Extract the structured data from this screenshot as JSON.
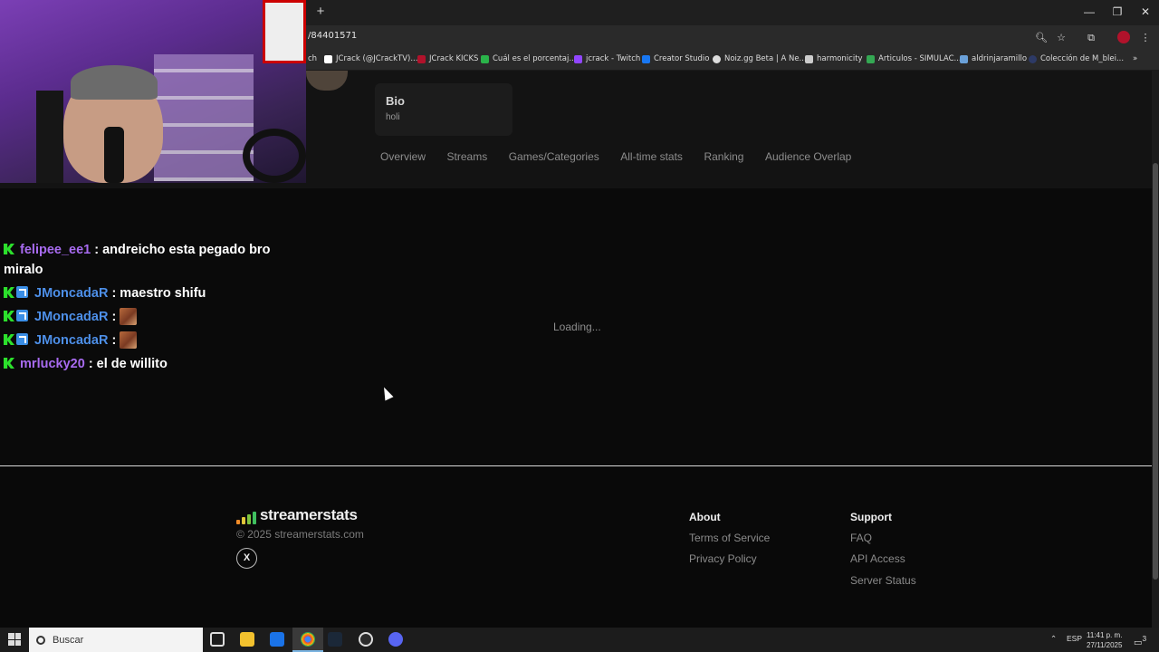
{
  "browser": {
    "url": "/84401571",
    "bookmarks": [
      {
        "label": "ch",
        "color": "#2a2a2a"
      },
      {
        "label": "JCrack (@JCrackTV)...",
        "color": "#ffffff"
      },
      {
        "label": "JCrack KICKS",
        "color": "#b1122b"
      },
      {
        "label": "Cuál es el porcentaj...",
        "color": "#2ab34a"
      },
      {
        "label": "jcrack - Twitch",
        "color": "#9146ff"
      },
      {
        "label": "Creator Studio",
        "color": "#1877f2"
      },
      {
        "label": "Noiz.gg Beta | A Ne...",
        "color": "#dddddd"
      },
      {
        "label": "harmonicity",
        "color": "#cccccc"
      },
      {
        "label": "Articulos - SIMULAC...",
        "color": "#34a853"
      },
      {
        "label": "aldrinjaramillo",
        "color": "#6aa0d8"
      },
      {
        "label": "Colección de M_blei...",
        "color": "#2d3a66"
      }
    ]
  },
  "profile": {
    "bio_title": "Bio",
    "bio_text": "holi",
    "tabs": [
      "Overview",
      "Streams",
      "Games/Categories",
      "All-time stats",
      "Ranking",
      "Audience Overlap"
    ],
    "loading": "Loading..."
  },
  "chat": {
    "messages": [
      {
        "user": "felipee_ee1",
        "text": ": andreicho esta pegado bro miralo",
        "badges": [
          "k"
        ],
        "color": "purple"
      },
      {
        "user": "JMoncadaR",
        "text": ": maestro shifu",
        "badges": [
          "k",
          "b"
        ],
        "color": "blue"
      },
      {
        "user": "JMoncadaR",
        "text": ":",
        "badges": [
          "k",
          "b"
        ],
        "color": "blue",
        "emote": true
      },
      {
        "user": "JMoncadaR",
        "text": ":",
        "badges": [
          "k",
          "b"
        ],
        "color": "blue",
        "emote": true
      },
      {
        "user": "mrlucky20",
        "text": ": el de willito",
        "badges": [
          "k"
        ],
        "color": "purple"
      }
    ]
  },
  "footer": {
    "brand": "streamerstats",
    "copyright": "© 2025 streamerstats.com",
    "social": "X",
    "about": {
      "heading": "About",
      "links": [
        "Terms of Service",
        "Privacy Policy"
      ]
    },
    "support": {
      "heading": "Support",
      "links": [
        "FAQ",
        "API Access",
        "Server Status"
      ]
    }
  },
  "taskbar": {
    "search_placeholder": "Buscar",
    "language": "ESP",
    "time": "11:41 p. m.",
    "date": "27/11/2025",
    "notifications": "3"
  }
}
